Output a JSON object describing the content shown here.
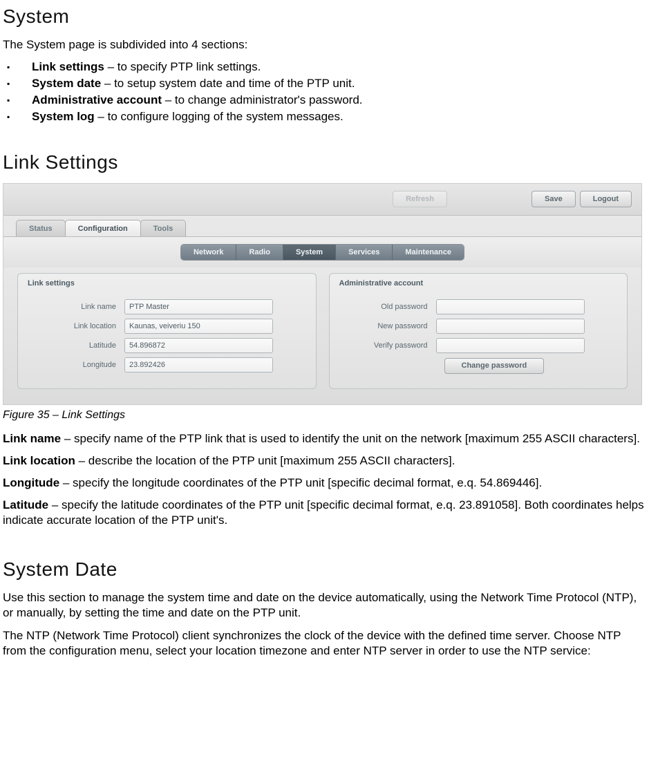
{
  "doc": {
    "h1_system": "System",
    "intro": "The System page is subdivided into 4 sections:",
    "bullets": [
      {
        "term": "Link settings",
        "desc": " – to specify PTP link settings."
      },
      {
        "term": "System date",
        "desc": " – to setup system date and time of the PTP unit."
      },
      {
        "term": "Administrative account",
        "desc": " – to change administrator's password."
      },
      {
        "term": "System log",
        "desc": " – to configure logging of the system messages."
      }
    ],
    "h1_link": "Link Settings",
    "fig_caption": "Figure 35 – Link Settings",
    "defs": [
      {
        "term": "Link name",
        "desc": " – specify name of the PTP link that is used to identify the unit on the network [maximum 255 ASCII characters]."
      },
      {
        "term": "Link location",
        "desc": " – describe the location of the PTP unit [maximum 255 ASCII characters]."
      },
      {
        "term": "Longitude",
        "desc": " – specify the longitude coordinates of the PTP unit [specific decimal format, e.q. 54.869446]."
      },
      {
        "term": "Latitude",
        "desc": " – specify the latitude coordinates of the PTP unit [specific decimal format, e.q. 23.891058]. Both coordinates helps indicate accurate location of the PTP unit's."
      }
    ],
    "h1_sysdate": "System Date",
    "sysdate_p1": "Use this section to manage the system time and date on the device automatically, using the Network Time Protocol (NTP), or manually, by setting the time and date on the PTP unit.",
    "sysdate_p2": "The NTP (Network Time Protocol) client synchronizes the clock of the device with the defined time server. Choose NTP from the configuration menu, select your location timezone and enter NTP server in order to use the NTP service:"
  },
  "ui": {
    "topbar": {
      "refresh": "Refresh",
      "save": "Save",
      "logout": "Logout"
    },
    "tabs": {
      "status": "Status",
      "configuration": "Configuration",
      "tools": "Tools"
    },
    "subtabs": {
      "network": "Network",
      "radio": "Radio",
      "system": "System",
      "services": "Services",
      "maintenance": "Maintenance"
    },
    "link_panel": {
      "title": "Link settings",
      "fields": {
        "link_name_label": "Link name",
        "link_name_value": "PTP Master",
        "link_location_label": "Link location",
        "link_location_value": "Kaunas, veiveriu 150",
        "latitude_label": "Latitude",
        "latitude_value": "54.896872",
        "longitude_label": "Longitude",
        "longitude_value": "23.892426"
      }
    },
    "admin_panel": {
      "title": "Administrative account",
      "fields": {
        "old_pw_label": "Old password",
        "old_pw_value": "",
        "new_pw_label": "New password",
        "new_pw_value": "",
        "verify_pw_label": "Verify password",
        "verify_pw_value": ""
      },
      "change_btn": "Change password"
    }
  }
}
